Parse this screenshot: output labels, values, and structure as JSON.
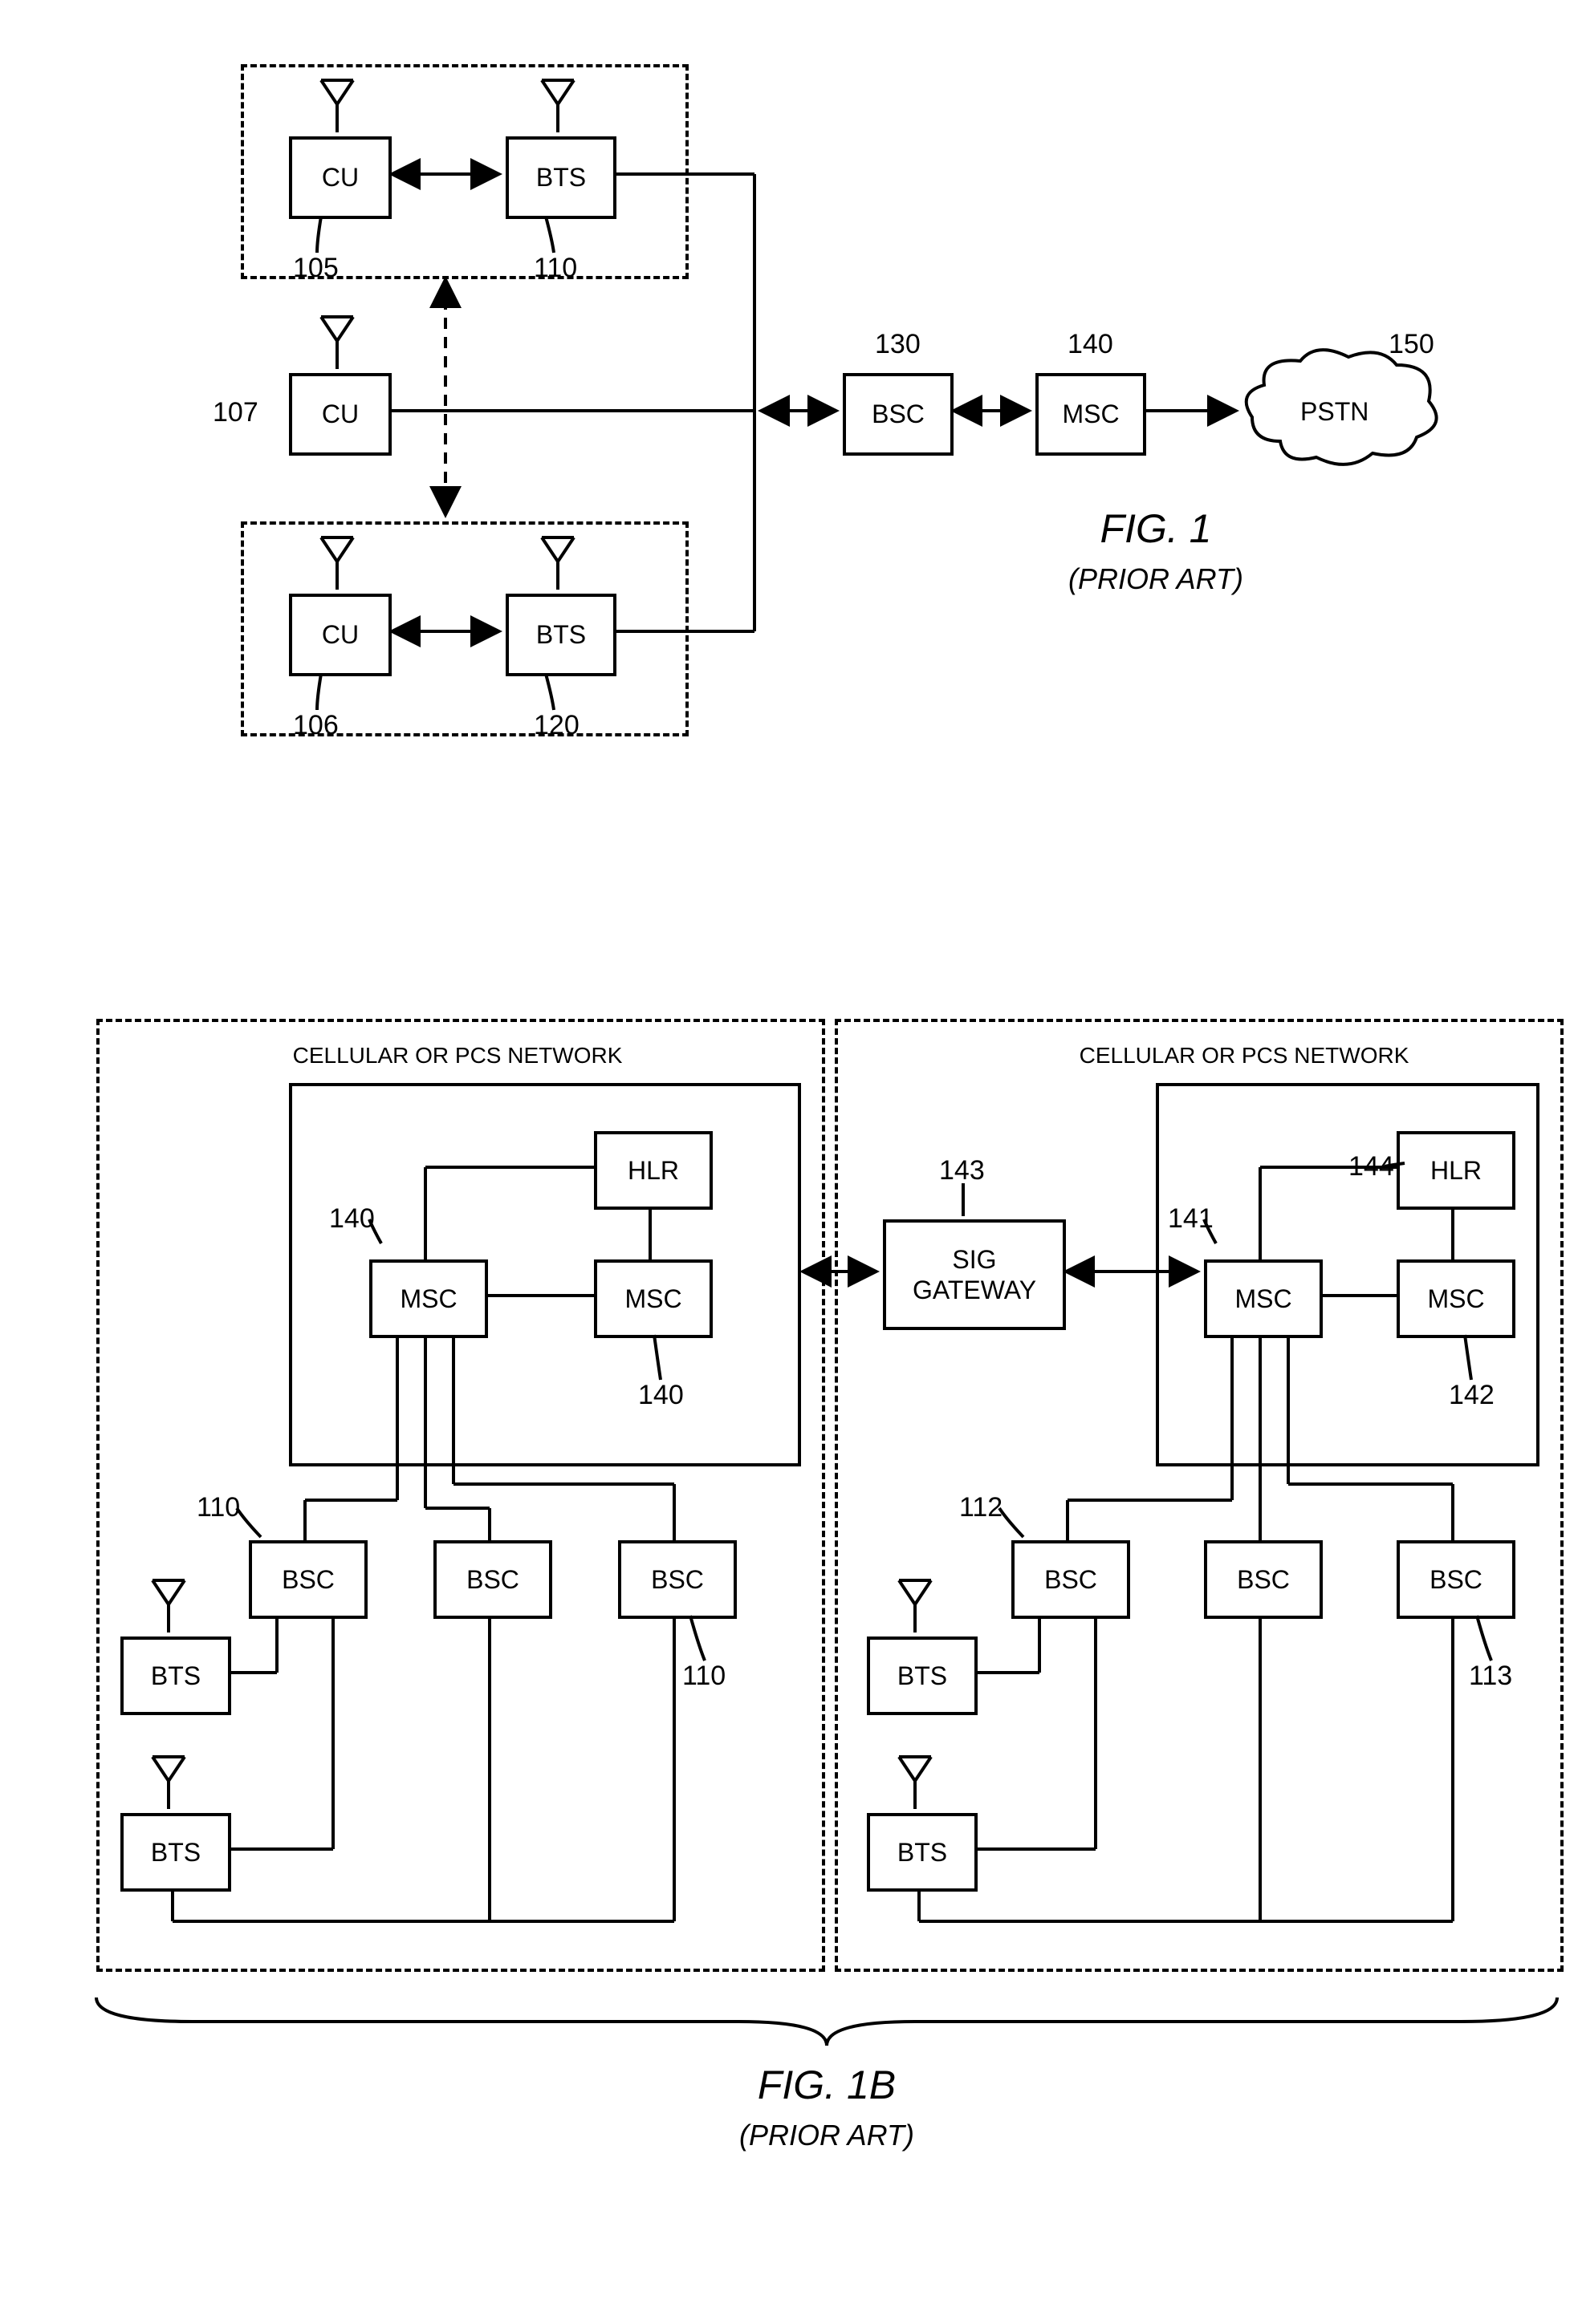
{
  "fig1": {
    "caption": "FIG. 1",
    "subcaption": "(PRIOR ART)",
    "boxes": {
      "cu105": "CU",
      "bts110": "BTS",
      "cu107": "CU",
      "cu106": "CU",
      "bts120": "BTS",
      "bsc130": "BSC",
      "msc140": "MSC",
      "pstn150": "PSTN"
    },
    "refs": {
      "r105": "105",
      "r110": "110",
      "r107": "107",
      "r106": "106",
      "r120": "120",
      "r130": "130",
      "r140": "140",
      "r150": "150"
    }
  },
  "fig1b": {
    "caption": "FIG. 1B",
    "subcaption": "(PRIOR ART)",
    "net_title_left": "CELLULAR OR PCS NETWORK",
    "net_title_right": "CELLULAR OR PCS NETWORK",
    "left": {
      "msc140a": "MSC",
      "msc140b": "MSC",
      "hlr": "HLR",
      "bsc1": "BSC",
      "bsc2": "BSC",
      "bsc3": "BSC",
      "bts1": "BTS",
      "bts2": "BTS",
      "r140a": "140",
      "r140b": "140",
      "r110a": "110",
      "r110b": "110"
    },
    "right": {
      "msc141": "MSC",
      "msc142": "MSC",
      "hlr144": "HLR",
      "sig_gateway": "SIG\nGATEWAY",
      "bsc1": "BSC",
      "bsc2": "BSC",
      "bsc3": "BSC",
      "bts1": "BTS",
      "bts2": "BTS",
      "r141": "141",
      "r142": "142",
      "r143": "143",
      "r144": "144",
      "r112": "112",
      "r113": "113"
    }
  }
}
